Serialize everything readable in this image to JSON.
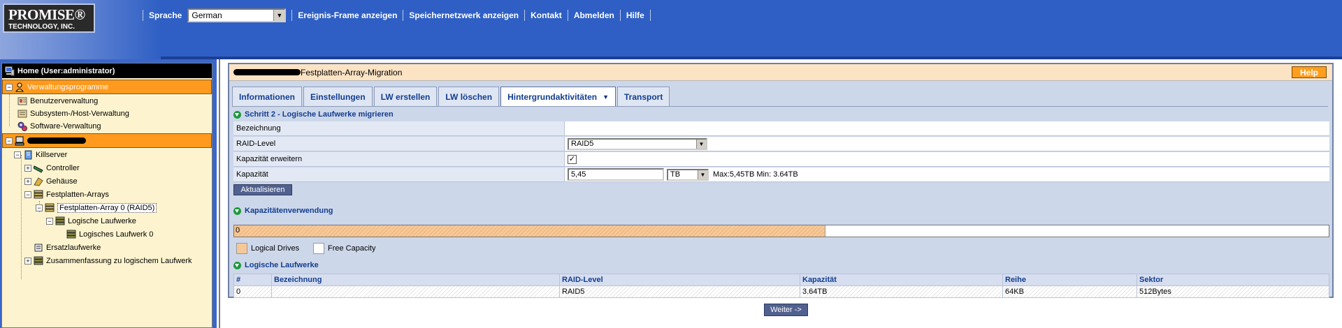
{
  "logo": {
    "line1": "PROMISE®",
    "line2": "TECHNOLOGY, INC."
  },
  "nav": {
    "language_label": "Sprache",
    "language_value": "German",
    "items": [
      "Ereignis-Frame anzeigen",
      "Speichernetzwerk anzeigen",
      "Kontakt",
      "Abmelden",
      "Hilfe"
    ]
  },
  "sidebar": {
    "home": "Home (User:administrator)",
    "admin_group": "Verwaltungsprogramme",
    "admin_items": [
      "Benutzerverwaltung",
      "Subsystem-/Host-Verwaltung",
      "Software-Verwaltung"
    ],
    "server": "Killserver",
    "tree": {
      "controller": "Controller",
      "enclosure": "Gehäuse",
      "disk_arrays": "Festplatten-Arrays",
      "array0": "Festplatten-Array 0 (RAID5)",
      "logical_drives": "Logische Laufwerke",
      "logical_drive0": "Logisches Laufwerk 0",
      "spare_drives": "Ersatzlaufwerke",
      "summary": "Zusammenfassung zu logischem Laufwerk"
    }
  },
  "panel": {
    "title": "Festplatten-Array-Migration",
    "help": "Help",
    "tabs": [
      "Informationen",
      "Einstellungen",
      "LW erstellen",
      "LW löschen",
      "Hintergrundaktivitäten",
      "Transport"
    ],
    "active_tab": "Hintergrundaktivitäten",
    "step_heading": "Schritt 2 - Logische Laufwerke migrieren",
    "form": {
      "name_label": "Bezeichnung",
      "name_value": "",
      "raid_label": "RAID-Level",
      "raid_value": "RAID5",
      "expand_label": "Kapazität erweitern",
      "expand_checked": true,
      "expand_mark": "✓",
      "capacity_label": "Kapazität",
      "capacity_value": "5,45",
      "capacity_unit": "TB",
      "capacity_range": "Max:5,45TB Min: 3.64TB"
    },
    "update_button": "Aktualisieren",
    "usage_heading": "Kapazitätenverwendung",
    "usage_bar_label": "0",
    "usage_fraction": 0.54,
    "legend": [
      {
        "label": "Logical Drives",
        "color": "#f6c898"
      },
      {
        "label": "Free Capacity",
        "color": "#ffffff"
      }
    ],
    "ld_heading": "Logische Laufwerke",
    "ld_table": {
      "headers": [
        "#",
        "Bezeichnung",
        "RAID-Level",
        "Kapazität",
        "Reihe",
        "Sektor"
      ],
      "rows": [
        [
          "0",
          "",
          "RAID5",
          "3.64TB",
          "64KB",
          "512Bytes"
        ]
      ]
    },
    "next_button": "Weiter ->"
  },
  "colors": {
    "nav_bg": "#2f5fc4",
    "accent_orange": "#ff9a1e",
    "panel_bg": "#cdd7ea",
    "title_bg": "#fbe3c4"
  }
}
